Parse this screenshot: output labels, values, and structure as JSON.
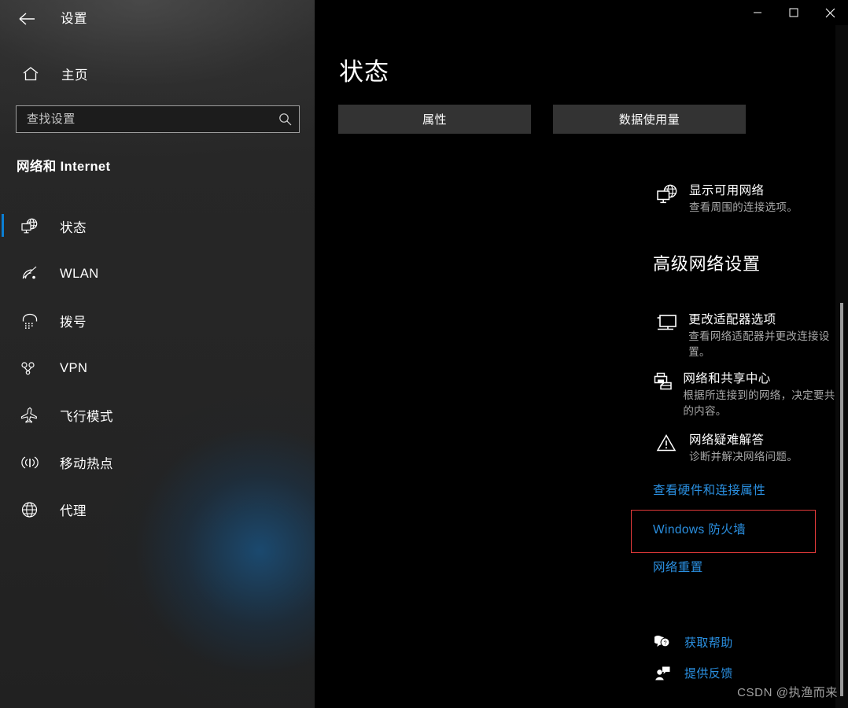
{
  "window": {
    "title": "设置",
    "back_icon": "back-arrow-icon",
    "controls": [
      {
        "name": "minimize",
        "glyph": "minimize-icon"
      },
      {
        "name": "maximize",
        "glyph": "maximize-icon"
      },
      {
        "name": "close",
        "glyph": "close-icon"
      }
    ]
  },
  "sidebar": {
    "home_label": "主页",
    "home_icon": "home-icon",
    "search": {
      "placeholder": "查找设置",
      "value": "",
      "icon": "search-icon"
    },
    "category": "网络和 Internet",
    "items": [
      {
        "label": "状态",
        "icon": "network-status-icon",
        "selected": true
      },
      {
        "label": "WLAN",
        "icon": "wifi-icon",
        "selected": false
      },
      {
        "label": "拨号",
        "icon": "dialup-phone-icon",
        "selected": false
      },
      {
        "label": "VPN",
        "icon": "vpn-icon",
        "selected": false
      },
      {
        "label": "飞行模式",
        "icon": "airplane-icon",
        "selected": false
      },
      {
        "label": "移动热点",
        "icon": "hotspot-icon",
        "selected": false
      },
      {
        "label": "代理",
        "icon": "globe-proxy-icon",
        "selected": false
      }
    ],
    "accent_color": "#0b7fd4"
  },
  "main": {
    "page_title": "状态",
    "buttons": [
      {
        "label": "属性",
        "name": "properties-button"
      },
      {
        "label": "数据使用量",
        "name": "data-usage-button"
      }
    ],
    "show_networks": {
      "title": "显示可用网络",
      "subtitle": "查看周围的连接选项。",
      "icon": "monitor-globe-icon"
    },
    "advanced_heading": "高级网络设置",
    "advanced_items": [
      {
        "title": "更改适配器选项",
        "subtitle": "查看网络适配器并更改连接设置。",
        "icon": "monitor-icon"
      },
      {
        "title": "网络和共享中心",
        "subtitle": "根据所连接到的网络，决定要共享的内容。",
        "icon": "printer-folder-icon"
      },
      {
        "title": "网络疑难解答",
        "subtitle": "诊断并解决网络问题。",
        "icon": "warning-triangle-icon"
      }
    ],
    "links": [
      {
        "label": "查看硬件和连接属性",
        "name": "view-hardware-link",
        "highlighted": false
      },
      {
        "label": "Windows 防火墙",
        "name": "windows-firewall-link",
        "highlighted": true
      },
      {
        "label": "网络重置",
        "name": "network-reset-link",
        "highlighted": false
      }
    ],
    "highlight_color": "#e33a3a",
    "link_color": "#2a8fe0",
    "help_links": [
      {
        "label": "获取帮助",
        "icon": "question-bubble-icon"
      },
      {
        "label": "提供反馈",
        "icon": "feedback-person-icon"
      }
    ]
  },
  "watermark": "CSDN @执渔而来"
}
